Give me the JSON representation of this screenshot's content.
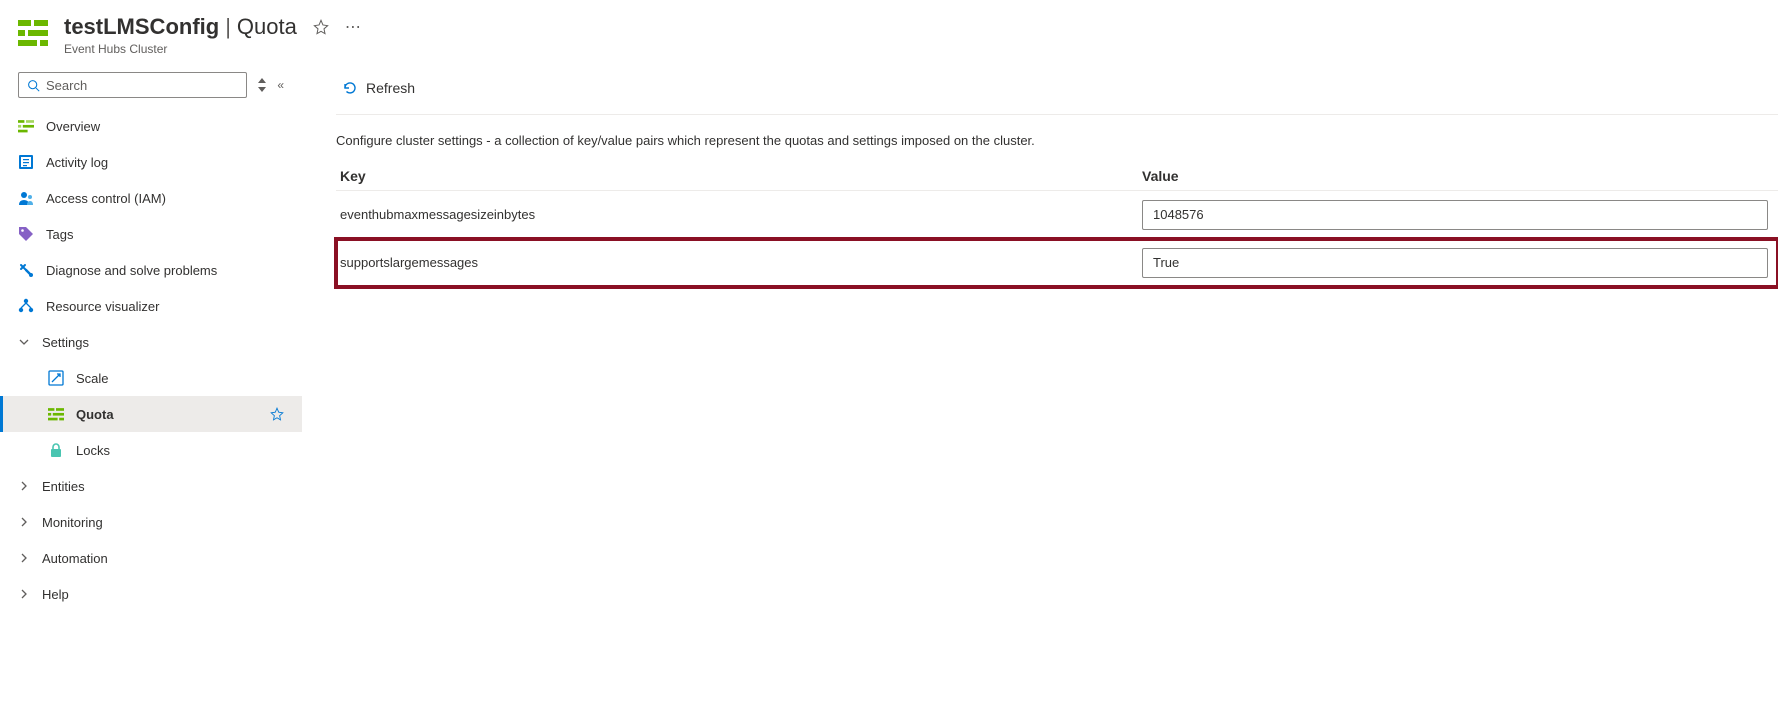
{
  "header": {
    "resource_name": "testLMSConfig",
    "section": "Quota",
    "subtype": "Event Hubs Cluster"
  },
  "sidebar": {
    "search_placeholder": "Search",
    "items": [
      {
        "label": "Overview"
      },
      {
        "label": "Activity log"
      },
      {
        "label": "Access control (IAM)"
      },
      {
        "label": "Tags"
      },
      {
        "label": "Diagnose and solve problems"
      },
      {
        "label": "Resource visualizer"
      }
    ],
    "settings_label": "Settings",
    "settings_children": [
      {
        "label": "Scale"
      },
      {
        "label": "Quota"
      },
      {
        "label": "Locks"
      }
    ],
    "groups": [
      {
        "label": "Entities"
      },
      {
        "label": "Monitoring"
      },
      {
        "label": "Automation"
      },
      {
        "label": "Help"
      }
    ]
  },
  "main": {
    "refresh_label": "Refresh",
    "description": "Configure cluster settings - a collection of key/value pairs which represent the quotas and settings imposed on the cluster.",
    "columns": {
      "key": "Key",
      "value": "Value"
    },
    "rows": [
      {
        "key": "eventhubmaxmessagesizeinbytes",
        "value": "1048576"
      },
      {
        "key": "supportslargemessages",
        "value": "True"
      }
    ]
  }
}
